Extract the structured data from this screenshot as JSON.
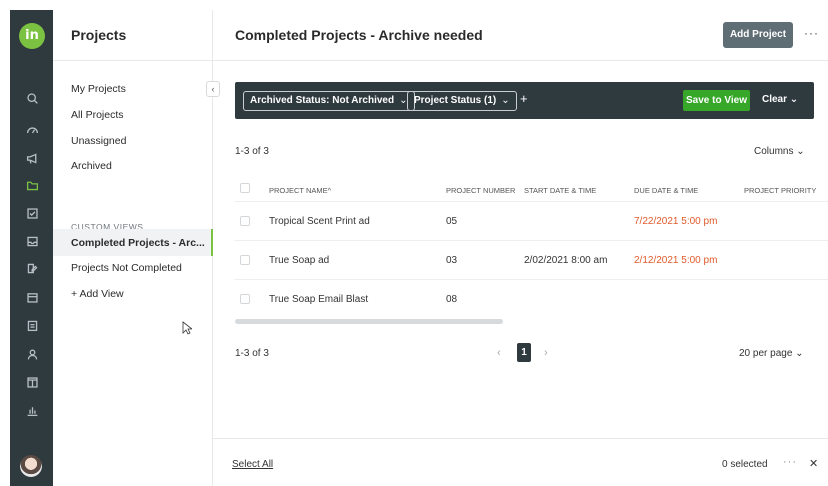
{
  "app": {
    "logo_text": "in"
  },
  "rail": {
    "icons": [
      "search-icon",
      "dashboard-icon",
      "megaphone-icon",
      "folder-icon",
      "checkbox-icon",
      "inbox-icon",
      "edit-icon",
      "calendar-icon",
      "clipboard-icon",
      "person-icon",
      "board-icon",
      "bar-chart-icon"
    ],
    "active_icon": "folder-icon"
  },
  "sidebar": {
    "title": "Projects",
    "items": [
      "My Projects",
      "All Projects",
      "Unassigned",
      "Archived"
    ],
    "section_label": "CUSTOM VIEWS",
    "views": [
      "Completed Projects - Arc...",
      "Projects Not Completed"
    ],
    "add_view": "+  Add View"
  },
  "header": {
    "title": "Completed Projects - Archive needed",
    "add_project": "Add Project",
    "more": "···"
  },
  "filters": {
    "chips": [
      "Archived Status: Not Archived",
      "Project Status (1)"
    ],
    "add": "+",
    "save_view": "Save to View",
    "clear": "Clear"
  },
  "table": {
    "count_label": "1-3 of 3",
    "columns_label": "Columns",
    "headers": [
      "PROJECT NAME^",
      "PROJECT NUMBER",
      "START DATE & TIME",
      "DUE DATE & TIME",
      "PROJECT PRIORITY"
    ],
    "rows": [
      {
        "name": "Tropical Scent Print ad",
        "number": "05",
        "start": "",
        "due": "7/22/2021 5:00 pm"
      },
      {
        "name": "True Soap ad",
        "number": "03",
        "start": "2/02/2021 8:00 am",
        "due": "2/12/2021 5:00 pm"
      },
      {
        "name": "True Soap Email Blast",
        "number": "08",
        "start": "",
        "due": ""
      }
    ],
    "due_color": "#e05a2b"
  },
  "pagination": {
    "count_label": "1-3 of 3",
    "prev": "‹",
    "current_page": "1",
    "next": "›",
    "per_page": "20 per page"
  },
  "footer": {
    "select_all": "Select All",
    "selected": "0 selected",
    "more": "···",
    "close": "✕"
  },
  "colors": {
    "accent_green": "#7cc242",
    "dark": "#2f3a3f",
    "save_green": "#37a72a"
  }
}
